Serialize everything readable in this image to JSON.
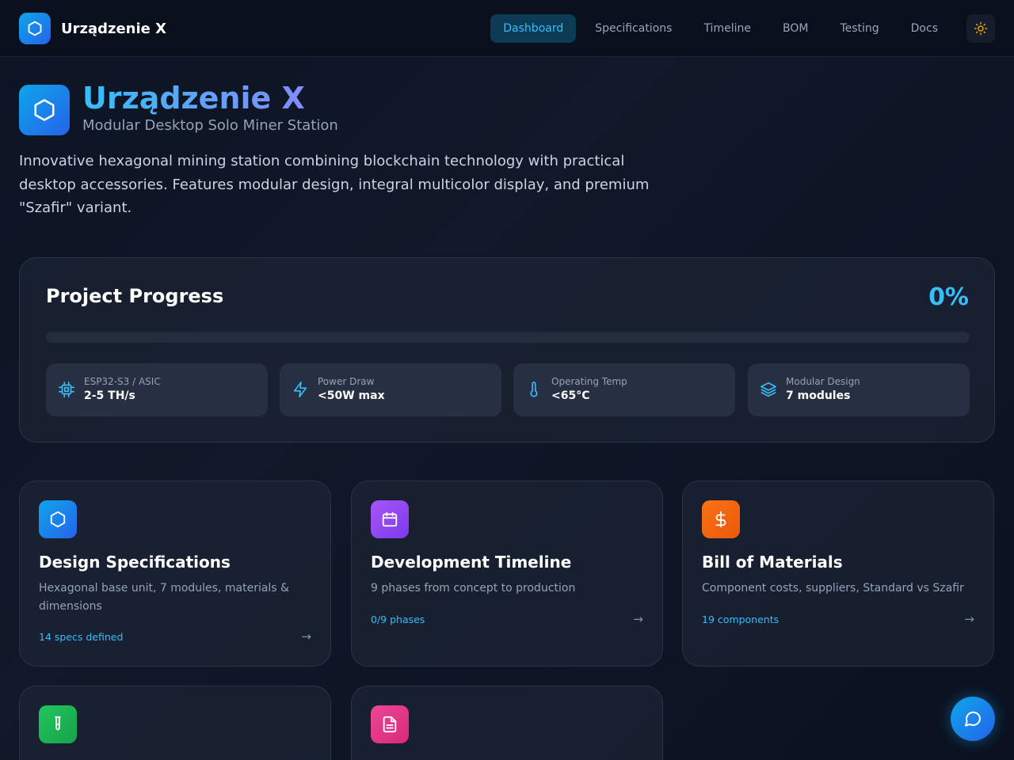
{
  "header": {
    "brand_name": "Urządzenie X",
    "nav": [
      {
        "label": "Dashboard",
        "active": true
      },
      {
        "label": "Specifications",
        "active": false
      },
      {
        "label": "Timeline",
        "active": false
      },
      {
        "label": "BOM",
        "active": false
      },
      {
        "label": "Testing",
        "active": false
      },
      {
        "label": "Docs",
        "active": false
      }
    ],
    "theme_icon": "sun-icon"
  },
  "hero": {
    "title": "Urządzenie X",
    "subtitle": "Modular Desktop Solo Miner Station",
    "description": "Innovative hexagonal mining station combining blockchain technology with practical desktop accessories. Features modular design, integral multicolor display, and premium \"Szafir\" variant."
  },
  "progress": {
    "title": "Project Progress",
    "percent_label": "0%",
    "percent_value": 0,
    "stats": [
      {
        "icon": "cpu-icon",
        "label": "ESP32-S3 / ASIC",
        "value": "2-5 TH/s"
      },
      {
        "icon": "lightning-icon",
        "label": "Power Draw",
        "value": "<50W max"
      },
      {
        "icon": "thermometer-icon",
        "label": "Operating Temp",
        "value": "<65°C"
      },
      {
        "icon": "layers-icon",
        "label": "Modular Design",
        "value": "7 modules"
      }
    ]
  },
  "cards": [
    {
      "icon": "hexagon-icon",
      "color": "#0ea5e9",
      "title": "Design Specifications",
      "description": "Hexagonal base unit, 7 modules, materials & dimensions",
      "meta": "14 specs defined"
    },
    {
      "icon": "calendar-icon",
      "color": "#8b5cf6",
      "title": "Development Timeline",
      "description": "9 phases from concept to production",
      "meta": "0/9 phases"
    },
    {
      "icon": "dollar-icon",
      "color": "#f97316",
      "title": "Bill of Materials",
      "description": "Component costs, suppliers, Standard vs Szafir",
      "meta": "19 components"
    },
    {
      "icon": "test-tube-icon",
      "color": "#22c55e"
    },
    {
      "icon": "document-icon",
      "color": "#ec4899"
    }
  ],
  "colors": {
    "accent": "#38bdf8",
    "background": "#0d1424",
    "card": "#1c2434"
  },
  "chat_icon": "chat-bubble-icon"
}
